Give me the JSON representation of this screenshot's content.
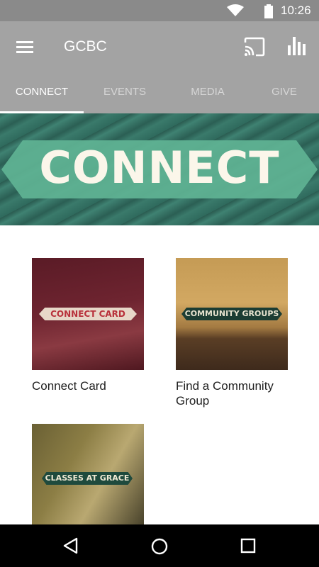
{
  "status_bar": {
    "time": "10:26",
    "icons": [
      "wifi-icon",
      "battery-icon"
    ]
  },
  "toolbar": {
    "title": "GCBC",
    "icons": [
      "menu-icon",
      "cast-icon",
      "bar-chart-icon"
    ]
  },
  "tabs": [
    {
      "label": "CONNECT",
      "active": true
    },
    {
      "label": "EVENTS",
      "active": false
    },
    {
      "label": "MEDIA",
      "active": false
    },
    {
      "label": "GIVE",
      "active": false
    }
  ],
  "hero": {
    "text": "CONNECT"
  },
  "cards": [
    {
      "image_label": "CONNECT CARD",
      "caption": "Connect Card"
    },
    {
      "image_label": "COMMUNITY GROUPS",
      "caption": "Find a Community Group"
    },
    {
      "image_label": "CLASSES AT GRACE",
      "caption": ""
    }
  ],
  "nav_bar": {
    "icons": [
      "back-icon",
      "home-icon",
      "recent-apps-icon"
    ]
  },
  "colors": {
    "toolbar": "#a3a3a3",
    "status_bar": "#8a8a8a",
    "hero_green": "#3a7a6b",
    "nav_bar": "#000000"
  }
}
